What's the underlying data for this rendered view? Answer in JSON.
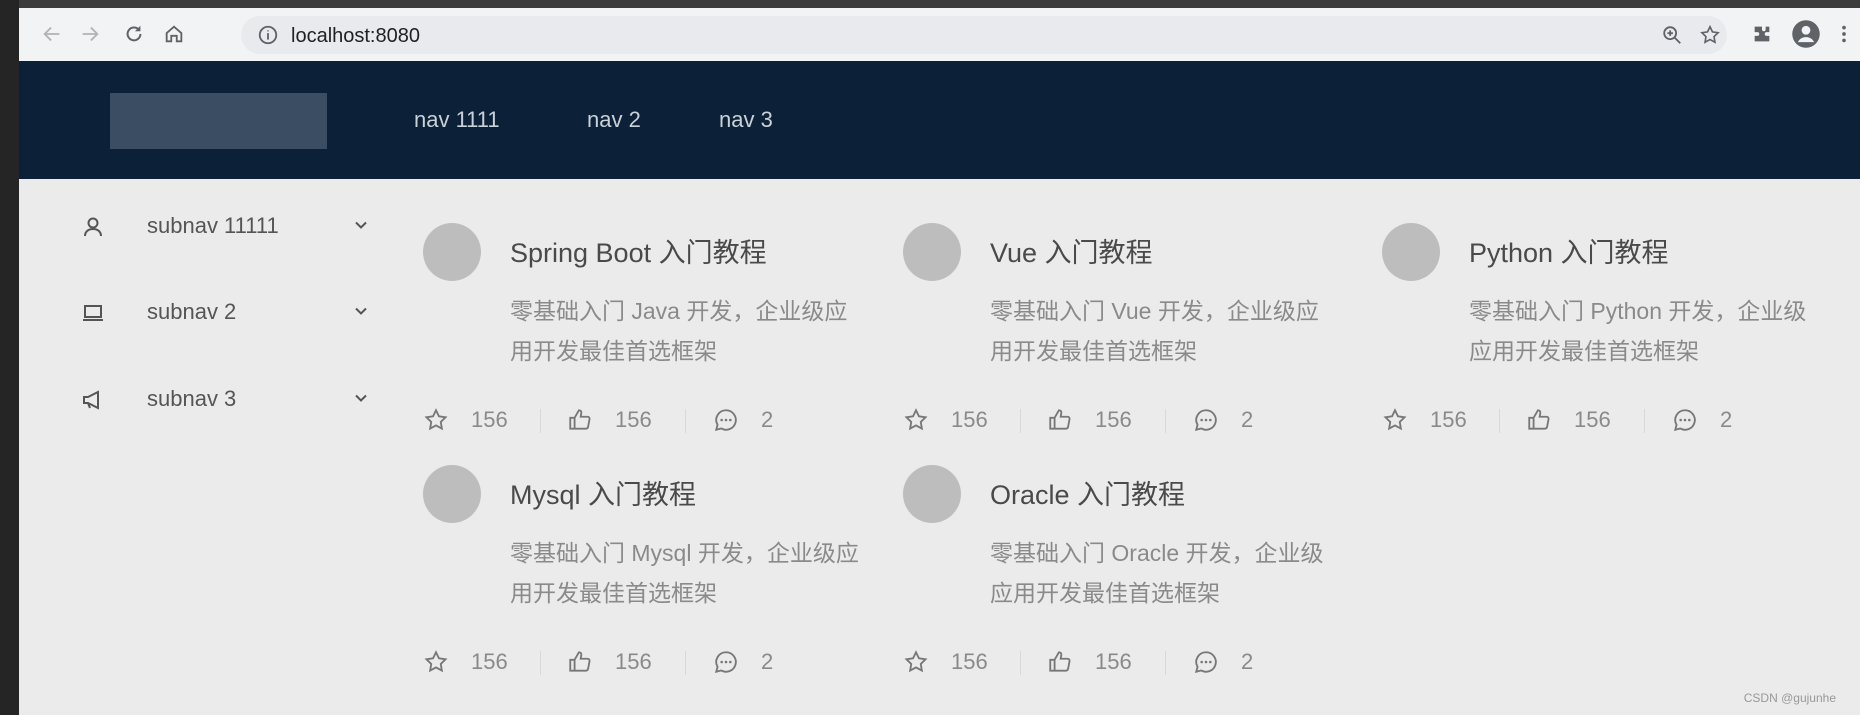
{
  "browser": {
    "url": "localhost:8080"
  },
  "header": {
    "nav": [
      "nav 1111",
      "nav 2",
      "nav 3"
    ]
  },
  "sidebar": {
    "items": [
      {
        "label": "subnav 11111",
        "icon": "user-icon"
      },
      {
        "label": "subnav 2",
        "icon": "laptop-icon"
      },
      {
        "label": "subnav 3",
        "icon": "notification-icon"
      }
    ]
  },
  "cards": [
    {
      "title": "Spring Boot 入门教程",
      "desc": "零基础入门 Java 开发，企业级应用开发最佳首选框架",
      "stars": "156",
      "likes": "156",
      "comments": "2"
    },
    {
      "title": "Vue 入门教程",
      "desc": "零基础入门 Vue 开发，企业级应用开发最佳首选框架",
      "stars": "156",
      "likes": "156",
      "comments": "2"
    },
    {
      "title": "Python 入门教程",
      "desc": "零基础入门 Python 开发，企业级应用开发最佳首选框架",
      "stars": "156",
      "likes": "156",
      "comments": "2"
    },
    {
      "title": "Mysql 入门教程",
      "desc": "零基础入门 Mysql 开发，企业级应用开发最佳首选框架",
      "stars": "156",
      "likes": "156",
      "comments": "2"
    },
    {
      "title": "Oracle 入门教程",
      "desc": "零基础入门 Oracle 开发，企业级应用开发最佳首选框架",
      "stars": "156",
      "likes": "156",
      "comments": "2"
    }
  ],
  "watermark": "CSDN @gujunhe",
  "colors": {
    "header_bg": "#0c2138",
    "content_bg": "#ebebeb",
    "avatar": "#bdbdbd"
  }
}
